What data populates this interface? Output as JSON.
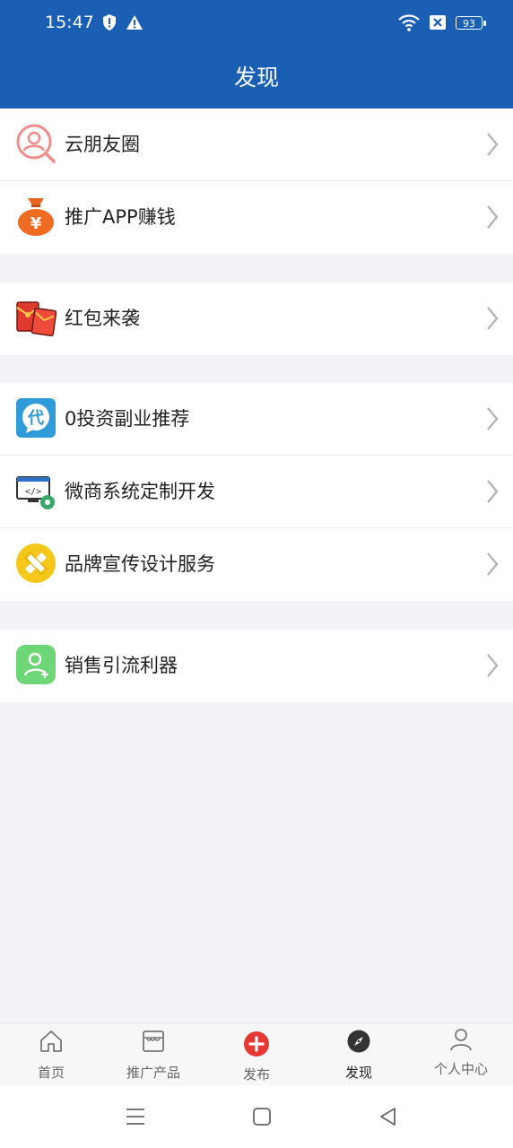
{
  "status_bar": {
    "time": "15:47",
    "battery": "93",
    "icons_left": [
      "shield-alert-icon",
      "warning-icon"
    ],
    "icons_right": [
      "wifi-icon",
      "sim-off-icon",
      "battery-icon"
    ]
  },
  "header": {
    "title": "发现"
  },
  "groups": [
    {
      "items": [
        {
          "label": "云朋友圈",
          "icon": "search-user-icon"
        },
        {
          "label": "推广APP赚钱",
          "icon": "money-bag-icon"
        }
      ]
    },
    {
      "items": [
        {
          "label": "红包来袭",
          "icon": "red-envelope-icon"
        }
      ]
    },
    {
      "items": [
        {
          "label": "0投资副业推荐",
          "icon": "dai-badge-icon"
        },
        {
          "label": "微商系统定制开发",
          "icon": "code-monitor-icon"
        },
        {
          "label": "品牌宣传设计服务",
          "icon": "ruler-pencil-icon"
        }
      ]
    },
    {
      "items": [
        {
          "label": "销售引流利器",
          "icon": "user-plus-icon"
        }
      ]
    }
  ],
  "tabs": [
    {
      "label": "首页",
      "icon": "home-icon"
    },
    {
      "label": "推广产品",
      "icon": "store-icon"
    },
    {
      "label": "发布",
      "icon": "add-circle-icon"
    },
    {
      "label": "发现",
      "icon": "compass-icon",
      "active": true
    },
    {
      "label": "个人中心",
      "icon": "person-icon"
    }
  ],
  "colors": {
    "primary": "#1a5fb4",
    "background": "#f2f3f7",
    "publish_red": "#e53935"
  }
}
